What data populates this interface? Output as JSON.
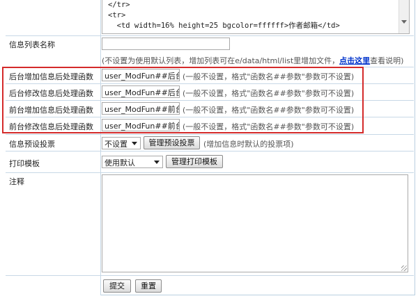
{
  "code": {
    "lines": [
      "</tr>",
      "<tr>",
      "  <td width=16% height=25 bgcolor=ffffff>作者邮箱</td>"
    ]
  },
  "list_name": {
    "label": "信息列表名称",
    "value": "",
    "hint_before": "(不设置为使用默认列表，增加列表可在e/data/html/list里增加文件，",
    "hint_link": "点击这里",
    "hint_after": "查看说明)"
  },
  "handlers": [
    {
      "label": "后台增加信息后处理函数",
      "value": "user_ModFun##后台增",
      "hint": "(一般不设置，格式\"函数名##参数\"参数可不设置)"
    },
    {
      "label": "后台修改信息后处理函数",
      "value": "user_ModFun##后台修",
      "hint": "(一般不设置，格式\"函数名##参数\"参数可不设置)"
    },
    {
      "label": "前台增加信息后处理函数",
      "value": "user_ModFun##前台增",
      "hint": "(一般不设置，格式\"函数名##参数\"参数可不设置)"
    },
    {
      "label": "前台修改信息后处理函数",
      "value": "user_ModFun##前台修",
      "hint": "(一般不设置，格式\"函数名##参数\"参数可不设置)"
    }
  ],
  "vote": {
    "label": "信息预设投票",
    "selected": "不设置",
    "manage_button": "管理预设投票",
    "hint": "(增加信息时默认的投票项)"
  },
  "print": {
    "label": "打印模板",
    "selected": "使用默认",
    "manage_button": "管理打印模板"
  },
  "note": {
    "label": "注释",
    "value": ""
  },
  "actions": {
    "submit": "提交",
    "reset": "重置"
  },
  "highlight_color": "#d42a2a"
}
